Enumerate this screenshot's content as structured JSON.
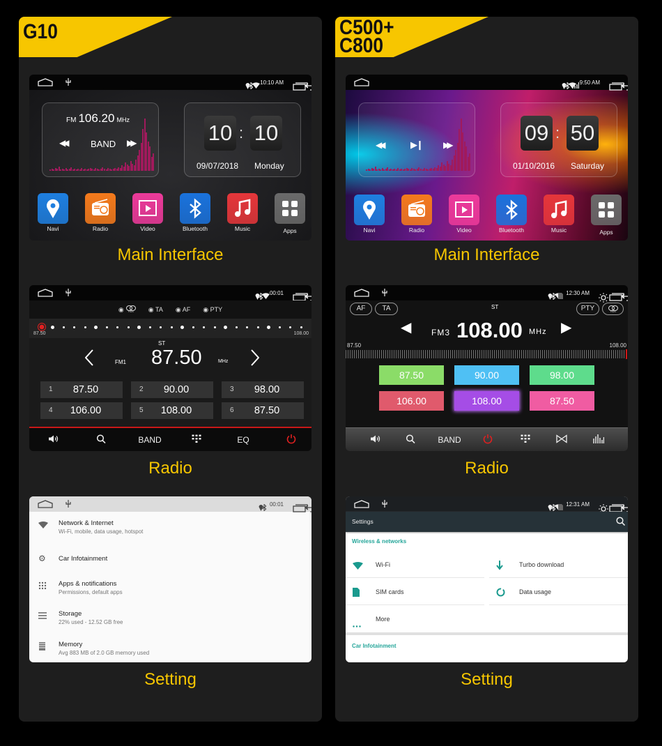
{
  "captions": {
    "main": "Main Interface",
    "radio": "Radio",
    "setting": "Setting"
  },
  "colors": {
    "accent_yellow": "#f7c600",
    "teal": "#26a69a",
    "radio_red": "#d01818"
  },
  "panels": [
    {
      "model_lines": [
        "G10"
      ],
      "main": {
        "status_time": "10:10 AM",
        "radio_widget": {
          "band": "FM",
          "frequency": "106.20",
          "unit": "MHz",
          "band_button": "BAND",
          "prev_icon": "rewind-icon",
          "next_icon": "fast-forward-icon"
        },
        "clock": {
          "hours": "10",
          "separator": ":",
          "minutes": "10",
          "date": "09/07/2018",
          "day": "Monday"
        },
        "apps": [
          {
            "label": "Navi",
            "icon": "map-pin-icon",
            "color": "#1e7fe0"
          },
          {
            "label": "Radio",
            "icon": "radio-icon",
            "color": "#f47a1c"
          },
          {
            "label": "Video",
            "icon": "video-icon",
            "color": "#ec3a9a"
          },
          {
            "label": "Bluetooth",
            "icon": "bluetooth-icon",
            "color": "#1a72dc"
          },
          {
            "label": "Music",
            "icon": "music-icon",
            "color": "#e5363a"
          },
          {
            "label": "Apps",
            "icon": "grid-icon",
            "color": "#6a6a6a"
          }
        ]
      },
      "radio": {
        "status_time": "00:01",
        "rds_options": [
          "TA",
          "AF",
          "PTY"
        ],
        "scale_min": "87.50",
        "scale_max": "108.00",
        "stereo": "ST",
        "band": "FM1",
        "frequency": "87.50",
        "unit": "MHz",
        "presets": [
          {
            "number": "1",
            "frequency": "87.50"
          },
          {
            "number": "2",
            "frequency": "90.00"
          },
          {
            "number": "3",
            "frequency": "98.00"
          },
          {
            "number": "4",
            "frequency": "106.00"
          },
          {
            "number": "5",
            "frequency": "108.00"
          },
          {
            "number": "6",
            "frequency": "87.50"
          }
        ],
        "bottom_bar": {
          "band": "BAND",
          "eq": "EQ"
        }
      },
      "settings": {
        "status_time": "00:01",
        "items": [
          {
            "title": "Network & Internet",
            "subtitle": "Wi-Fi, mobile, data usage, hotspot",
            "icon": "wifi-icon"
          },
          {
            "title": "Car Infotainment",
            "subtitle": "",
            "icon": "gear-icon"
          },
          {
            "title": "Apps & notifications",
            "subtitle": "Permissions, default apps",
            "icon": "apps-grid-icon"
          },
          {
            "title": "Storage",
            "subtitle": "22% used - 12.52 GB free",
            "icon": "storage-icon"
          },
          {
            "title": "Memory",
            "subtitle": "Avg 883 MB of 2.0 GB memory used",
            "icon": "memory-icon"
          }
        ]
      }
    },
    {
      "model_lines": [
        "C500+",
        "C800"
      ],
      "main": {
        "status_time": "9:50 AM",
        "media_widget": {
          "prev_icon": "rewind-icon",
          "play_icon": "play-pause-icon",
          "next_icon": "fast-forward-icon"
        },
        "clock": {
          "hours": "09",
          "separator": ":",
          "minutes": "50",
          "date": "01/10/2016",
          "day": "Saturday"
        },
        "apps": [
          {
            "label": "Navi",
            "icon": "map-pin-icon",
            "color": "#1e7fe0"
          },
          {
            "label": "Radio",
            "icon": "radio-icon",
            "color": "#f47a1c"
          },
          {
            "label": "Video",
            "icon": "video-icon",
            "color": "#ec3a9a"
          },
          {
            "label": "Bluetooth",
            "icon": "bluetooth-icon",
            "color": "#1a72dc"
          },
          {
            "label": "Music",
            "icon": "music-icon",
            "color": "#e5363a"
          },
          {
            "label": "Apps",
            "icon": "grid-icon",
            "color": "#6a6a6a"
          }
        ]
      },
      "radio": {
        "status_time": "12:30 AM",
        "pills": {
          "af": "AF",
          "ta": "TA",
          "pty": "PTY"
        },
        "stereo": "ST",
        "band": "FM3",
        "frequency": "108.00",
        "unit": "MHz",
        "scale_min": "87.50",
        "scale_max": "108.00",
        "presets": [
          {
            "frequency": "87.50",
            "color": "#8bdc68"
          },
          {
            "frequency": "90.00",
            "color": "#4fc0f4"
          },
          {
            "frequency": "98.00",
            "color": "#5edc8c"
          },
          {
            "frequency": "106.00",
            "color": "#e05a6c"
          },
          {
            "frequency": "108.00",
            "color": "#a54de6"
          },
          {
            "frequency": "87.50",
            "color": "#f05ca2"
          }
        ],
        "selected_preset": 4,
        "bottom_bar": {
          "band": "BAND"
        }
      },
      "settings": {
        "status_time": "12:31 AM",
        "header": "Settings",
        "section_wireless": "Wireless & networks",
        "items": [
          {
            "label": "Wi-Fi",
            "icon": "wifi-icon"
          },
          {
            "label": "Turbo download",
            "icon": "download-icon"
          },
          {
            "label": "SIM cards",
            "icon": "sim-card-icon"
          },
          {
            "label": "Data usage",
            "icon": "data-usage-icon"
          },
          {
            "label": "More",
            "icon": "more-icon"
          }
        ],
        "section_car": "Car Infotainment"
      }
    }
  ]
}
